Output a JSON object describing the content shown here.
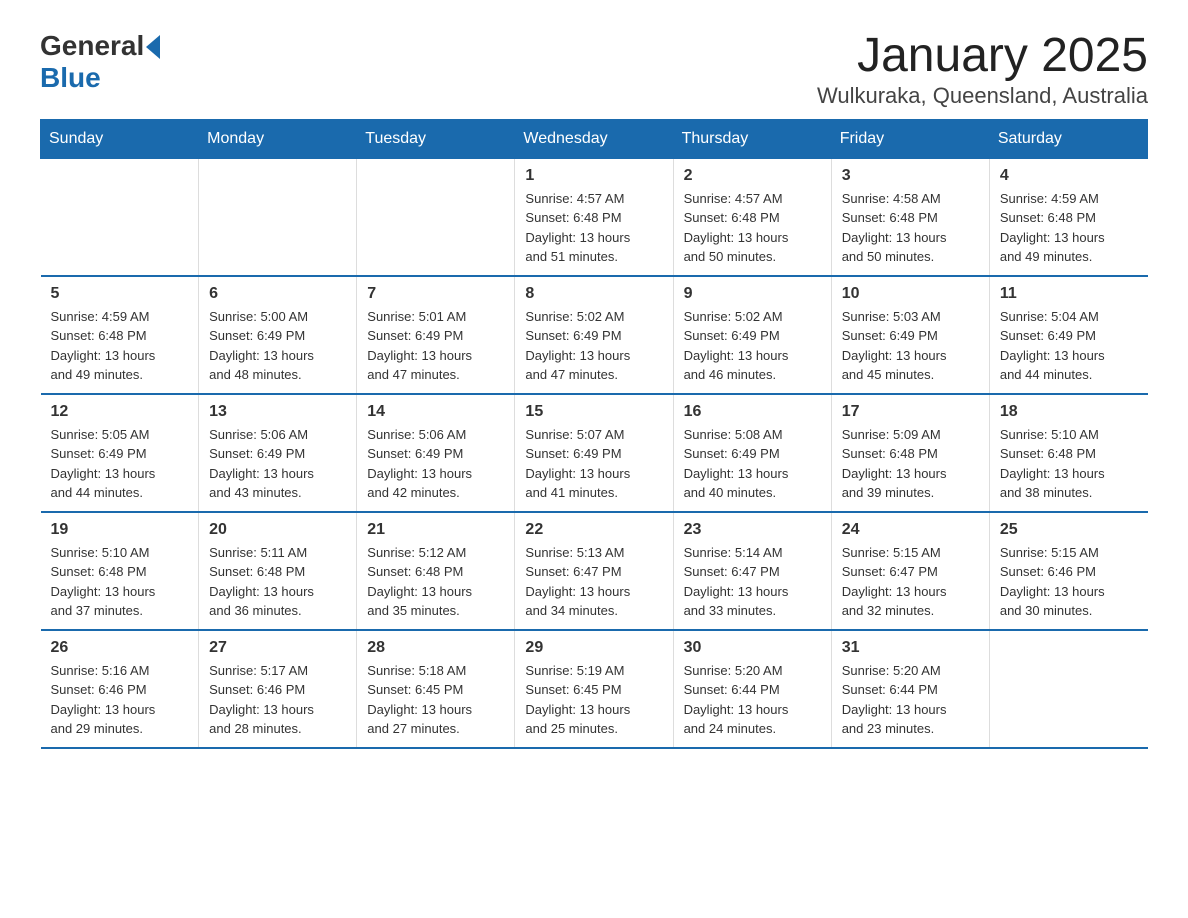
{
  "logo": {
    "general": "General",
    "blue": "Blue"
  },
  "header": {
    "title": "January 2025",
    "location": "Wulkuraka, Queensland, Australia"
  },
  "days_of_week": [
    "Sunday",
    "Monday",
    "Tuesday",
    "Wednesday",
    "Thursday",
    "Friday",
    "Saturday"
  ],
  "weeks": [
    [
      {
        "day": "",
        "info": ""
      },
      {
        "day": "",
        "info": ""
      },
      {
        "day": "",
        "info": ""
      },
      {
        "day": "1",
        "info": "Sunrise: 4:57 AM\nSunset: 6:48 PM\nDaylight: 13 hours\nand 51 minutes."
      },
      {
        "day": "2",
        "info": "Sunrise: 4:57 AM\nSunset: 6:48 PM\nDaylight: 13 hours\nand 50 minutes."
      },
      {
        "day": "3",
        "info": "Sunrise: 4:58 AM\nSunset: 6:48 PM\nDaylight: 13 hours\nand 50 minutes."
      },
      {
        "day": "4",
        "info": "Sunrise: 4:59 AM\nSunset: 6:48 PM\nDaylight: 13 hours\nand 49 minutes."
      }
    ],
    [
      {
        "day": "5",
        "info": "Sunrise: 4:59 AM\nSunset: 6:48 PM\nDaylight: 13 hours\nand 49 minutes."
      },
      {
        "day": "6",
        "info": "Sunrise: 5:00 AM\nSunset: 6:49 PM\nDaylight: 13 hours\nand 48 minutes."
      },
      {
        "day": "7",
        "info": "Sunrise: 5:01 AM\nSunset: 6:49 PM\nDaylight: 13 hours\nand 47 minutes."
      },
      {
        "day": "8",
        "info": "Sunrise: 5:02 AM\nSunset: 6:49 PM\nDaylight: 13 hours\nand 47 minutes."
      },
      {
        "day": "9",
        "info": "Sunrise: 5:02 AM\nSunset: 6:49 PM\nDaylight: 13 hours\nand 46 minutes."
      },
      {
        "day": "10",
        "info": "Sunrise: 5:03 AM\nSunset: 6:49 PM\nDaylight: 13 hours\nand 45 minutes."
      },
      {
        "day": "11",
        "info": "Sunrise: 5:04 AM\nSunset: 6:49 PM\nDaylight: 13 hours\nand 44 minutes."
      }
    ],
    [
      {
        "day": "12",
        "info": "Sunrise: 5:05 AM\nSunset: 6:49 PM\nDaylight: 13 hours\nand 44 minutes."
      },
      {
        "day": "13",
        "info": "Sunrise: 5:06 AM\nSunset: 6:49 PM\nDaylight: 13 hours\nand 43 minutes."
      },
      {
        "day": "14",
        "info": "Sunrise: 5:06 AM\nSunset: 6:49 PM\nDaylight: 13 hours\nand 42 minutes."
      },
      {
        "day": "15",
        "info": "Sunrise: 5:07 AM\nSunset: 6:49 PM\nDaylight: 13 hours\nand 41 minutes."
      },
      {
        "day": "16",
        "info": "Sunrise: 5:08 AM\nSunset: 6:49 PM\nDaylight: 13 hours\nand 40 minutes."
      },
      {
        "day": "17",
        "info": "Sunrise: 5:09 AM\nSunset: 6:48 PM\nDaylight: 13 hours\nand 39 minutes."
      },
      {
        "day": "18",
        "info": "Sunrise: 5:10 AM\nSunset: 6:48 PM\nDaylight: 13 hours\nand 38 minutes."
      }
    ],
    [
      {
        "day": "19",
        "info": "Sunrise: 5:10 AM\nSunset: 6:48 PM\nDaylight: 13 hours\nand 37 minutes."
      },
      {
        "day": "20",
        "info": "Sunrise: 5:11 AM\nSunset: 6:48 PM\nDaylight: 13 hours\nand 36 minutes."
      },
      {
        "day": "21",
        "info": "Sunrise: 5:12 AM\nSunset: 6:48 PM\nDaylight: 13 hours\nand 35 minutes."
      },
      {
        "day": "22",
        "info": "Sunrise: 5:13 AM\nSunset: 6:47 PM\nDaylight: 13 hours\nand 34 minutes."
      },
      {
        "day": "23",
        "info": "Sunrise: 5:14 AM\nSunset: 6:47 PM\nDaylight: 13 hours\nand 33 minutes."
      },
      {
        "day": "24",
        "info": "Sunrise: 5:15 AM\nSunset: 6:47 PM\nDaylight: 13 hours\nand 32 minutes."
      },
      {
        "day": "25",
        "info": "Sunrise: 5:15 AM\nSunset: 6:46 PM\nDaylight: 13 hours\nand 30 minutes."
      }
    ],
    [
      {
        "day": "26",
        "info": "Sunrise: 5:16 AM\nSunset: 6:46 PM\nDaylight: 13 hours\nand 29 minutes."
      },
      {
        "day": "27",
        "info": "Sunrise: 5:17 AM\nSunset: 6:46 PM\nDaylight: 13 hours\nand 28 minutes."
      },
      {
        "day": "28",
        "info": "Sunrise: 5:18 AM\nSunset: 6:45 PM\nDaylight: 13 hours\nand 27 minutes."
      },
      {
        "day": "29",
        "info": "Sunrise: 5:19 AM\nSunset: 6:45 PM\nDaylight: 13 hours\nand 25 minutes."
      },
      {
        "day": "30",
        "info": "Sunrise: 5:20 AM\nSunset: 6:44 PM\nDaylight: 13 hours\nand 24 minutes."
      },
      {
        "day": "31",
        "info": "Sunrise: 5:20 AM\nSunset: 6:44 PM\nDaylight: 13 hours\nand 23 minutes."
      },
      {
        "day": "",
        "info": ""
      }
    ]
  ]
}
